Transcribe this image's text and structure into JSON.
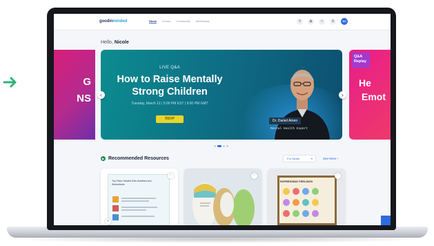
{
  "header": {
    "logo": {
      "part1": "goodin",
      "part2": "minded",
      "sub": "parenting"
    },
    "nav": [
      {
        "label": "Home",
        "active": true
      },
      {
        "label": "Library",
        "active": false
      },
      {
        "label": "Community",
        "active": false
      },
      {
        "label": "Workshops",
        "active": false
      }
    ],
    "icons": [
      "search-icon",
      "bell-icon",
      "calendar-icon",
      "settings-icon"
    ],
    "avatar_initials": "NJ"
  },
  "greeting": {
    "prefix": "Hello,",
    "name": "Nicole"
  },
  "carousel": {
    "prev_slide": {
      "line1": "G",
      "line2": "NS"
    },
    "main_slide": {
      "tag": "LIVE Q&A",
      "title_line1": "How to Raise Mentally",
      "title_line2": "Strong Children",
      "date": "Tuesday, March 12 | 5:00 PM EST | 9:00 PM GMT",
      "button": "RSVP",
      "expert_name": "Dr. Daniel Amen",
      "expert_role": "Mental Health Expert"
    },
    "next_slide": {
      "tag_line1": "Q&A",
      "tag_line2": "Replay",
      "line1": "He",
      "line2": "Emot"
    },
    "dots": 4,
    "active_dot": 1
  },
  "recommended": {
    "title": "Recommended Resources",
    "filter": "For Nicole",
    "see_more": "See More"
  },
  "cards": [
    {
      "type": "worksheet",
      "title": "Top Picks: Mindful Kids Activities and Worksheets"
    },
    {
      "type": "photo"
    },
    {
      "type": "poster",
      "title": "EXPRESSING FEELINGS"
    }
  ],
  "colors": {
    "accent": "#2f6be0",
    "hero_teal": "#0c8c8f",
    "pink": "#e81d89",
    "rsvp_yellow": "#e8d52a",
    "arrow_green": "#2fb57a"
  }
}
